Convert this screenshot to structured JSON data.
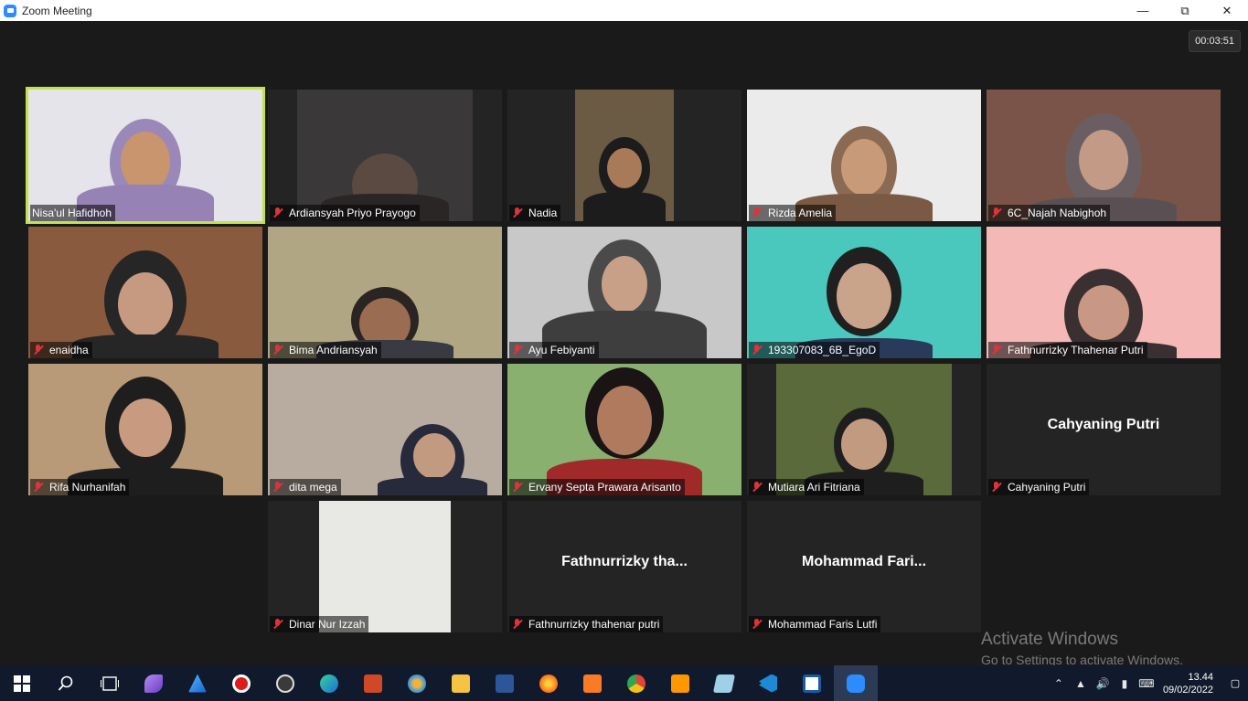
{
  "window": {
    "title": "Zoom Meeting",
    "minimize_icon": "minimize-icon",
    "restore_icon": "restore-icon",
    "close_icon": "close-icon"
  },
  "meeting": {
    "timer": "00:03:51",
    "participants": [
      {
        "name": "Nisa'ul Hafidhoh",
        "muted": false,
        "video": true,
        "active_speaker": true
      },
      {
        "name": "Ardiansyah Priyo Prayogo",
        "muted": true,
        "video": true
      },
      {
        "name": "Nadia",
        "muted": true,
        "video": true
      },
      {
        "name": "Rizda Amelia",
        "muted": true,
        "video": true
      },
      {
        "name": "6C_Najah Nabighoh",
        "muted": true,
        "video": true
      },
      {
        "name": "enaidha",
        "muted": true,
        "video": true
      },
      {
        "name": "Bima Andriansyah",
        "muted": true,
        "video": true
      },
      {
        "name": "Ayu Febiyanti",
        "muted": true,
        "video": true
      },
      {
        "name": "193307083_6B_EgoD",
        "muted": true,
        "video": true
      },
      {
        "name": "Fathnurrizky Thahenar Putri",
        "muted": true,
        "video": true
      },
      {
        "name": "Rifa Nurhanifah",
        "muted": true,
        "video": true
      },
      {
        "name": "dita mega",
        "muted": true,
        "video": true
      },
      {
        "name": "Ervany Septa Prawara Arisanto",
        "muted": true,
        "video": true
      },
      {
        "name": "Mutiara Ari Fitriana",
        "muted": true,
        "video": true
      },
      {
        "name": "Cahyaning Putri",
        "muted": true,
        "video": false,
        "display_name": "Cahyaning Putri"
      },
      {
        "name": "Dinar Nur Izzah",
        "muted": true,
        "video": true
      },
      {
        "name": "Fathnurrizky thahenar putri",
        "muted": true,
        "video": false,
        "display_name": "Fathnurrizky  tha..."
      },
      {
        "name": "Mohammad Faris Lutfi",
        "muted": true,
        "video": false,
        "display_name": "Mohammad  Fari..."
      }
    ]
  },
  "watermark": {
    "title": "Activate Windows",
    "subtitle": "Go to Settings to activate Windows."
  },
  "taskbar": {
    "icons": [
      "windows-start-icon",
      "search-icon",
      "task-view-icon",
      "pen-app-icon",
      "sail-app-icon",
      "record-icon",
      "obs-icon",
      "edge-icon",
      "powerpoint-icon",
      "davinci-icon",
      "file-explorer-icon",
      "word-icon",
      "firefox-icon",
      "xampp-icon",
      "chrome-icon",
      "sublime-icon",
      "notes-icon",
      "vscode-icon",
      "dictionary-icon",
      "zoom-icon"
    ],
    "time": "13.44",
    "date": "09/02/2022"
  }
}
